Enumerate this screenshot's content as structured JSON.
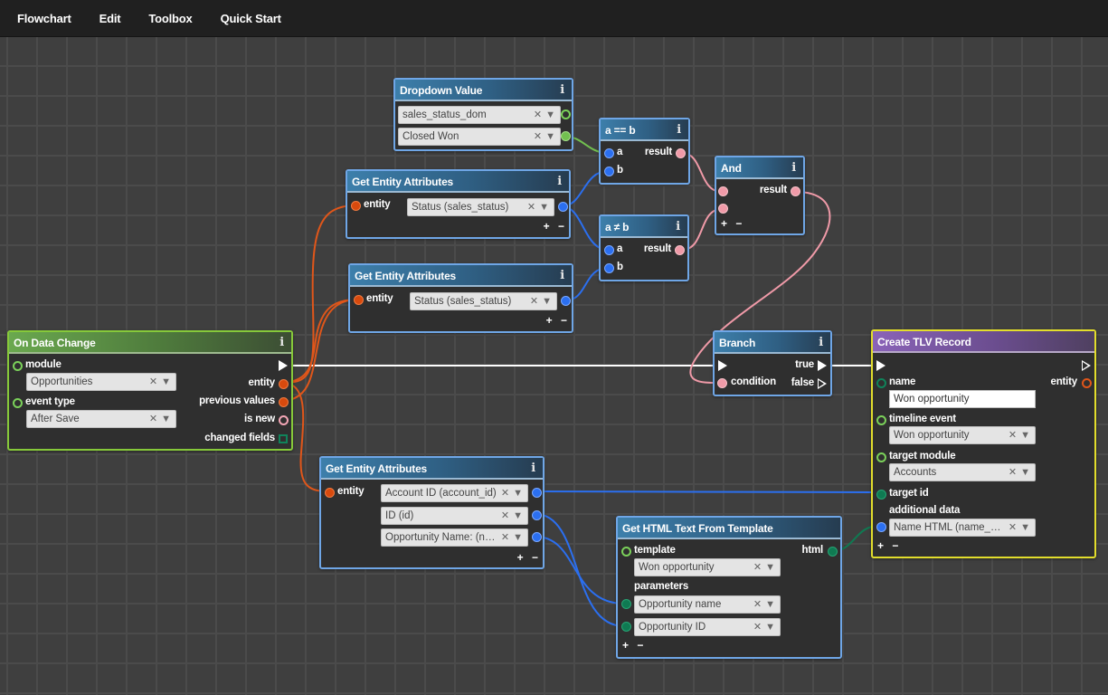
{
  "menubar": {
    "items": [
      "Flowchart",
      "Edit",
      "Toolbox",
      "Quick Start"
    ]
  },
  "colors": {
    "accent_blue": "#6fa6e6",
    "trigger_green": "#86c93a",
    "action_yellow": "#e2dd2c",
    "wire_flow": "#ffffff",
    "wire_entity": "#e0561a",
    "wire_value": "#2b6ff0",
    "wire_boolean": "#f09aa8",
    "wire_dropdown": "#72c050",
    "wire_html": "#0f7a52"
  },
  "nodes": {
    "on_data_change": {
      "title": "On Data Change",
      "module_label": "module",
      "module_value": "Opportunities",
      "event_type_label": "event type",
      "event_type_value": "After Save",
      "outputs": [
        "entity",
        "previous values",
        "is new",
        "changed fields"
      ]
    },
    "dropdown_value": {
      "title": "Dropdown Value",
      "dropdown_value": "sales_status_dom",
      "option_value": "Closed Won"
    },
    "get_entity_attributes_1": {
      "title": "Get Entity Attributes",
      "entity_label": "entity",
      "attributes": [
        "Status (sales_status)"
      ]
    },
    "get_entity_attributes_2": {
      "title": "Get Entity Attributes",
      "entity_label": "entity",
      "attributes": [
        "Status (sales_status)"
      ]
    },
    "get_entity_attributes_3": {
      "title": "Get Entity Attributes",
      "entity_label": "entity",
      "attributes": [
        "Account ID (account_id)",
        "ID (id)",
        "Opportunity Name: (name)"
      ]
    },
    "equals": {
      "title": "a == b",
      "input_a": "a",
      "input_b": "b",
      "output": "result"
    },
    "not_equals": {
      "title": "a ≠ b",
      "input_a": "a",
      "input_b": "b",
      "output": "result"
    },
    "and": {
      "title": "And",
      "output": "result"
    },
    "branch": {
      "title": "Branch",
      "condition_label": "condition",
      "true_label": "true",
      "false_label": "false"
    },
    "get_html_text": {
      "title": "Get HTML Text From Template",
      "template_label": "template",
      "template_value": "Won opportunity",
      "output": "html",
      "parameters_label": "parameters",
      "parameters": [
        "Opportunity name",
        "Opportunity ID"
      ]
    },
    "create_tlv_record": {
      "title": "Create TLV Record",
      "name_label": "name",
      "name_value": "Won opportunity",
      "entity_output": "entity",
      "timeline_event_label": "timeline event",
      "timeline_event_value": "Won opportunity",
      "target_module_label": "target module",
      "target_module_value": "Accounts",
      "target_id_label": "target id",
      "additional_data_label": "additional data",
      "additional_data_value": "Name HTML (name_html)"
    }
  },
  "symbols": {
    "info": "i",
    "clear": "✕",
    "dropdown": "▼",
    "add_remove": "+ −"
  }
}
